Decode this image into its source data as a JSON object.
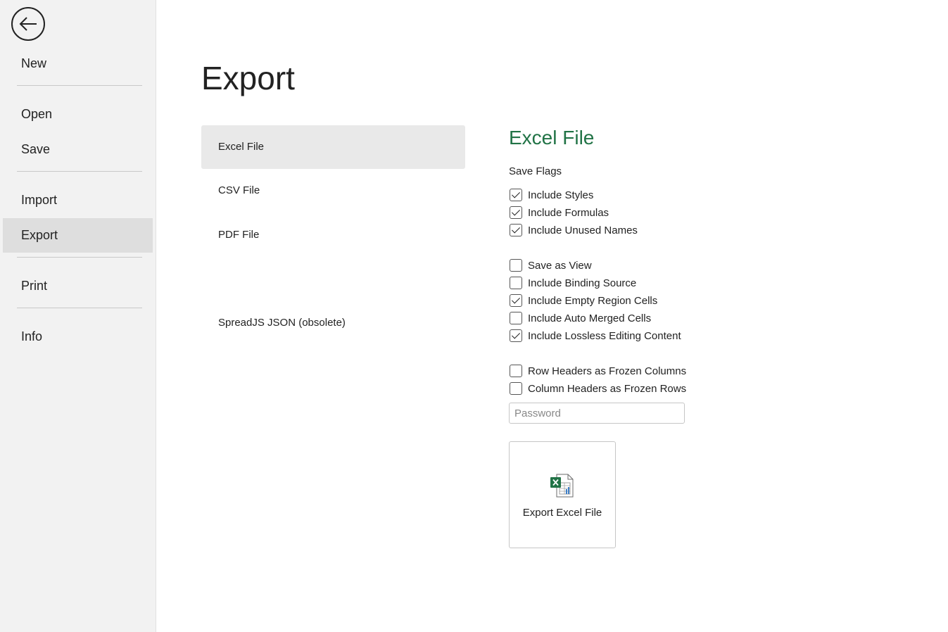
{
  "sidebar": {
    "items": [
      {
        "label": "New"
      },
      {
        "label": "Open"
      },
      {
        "label": "Save"
      },
      {
        "label": "Import"
      },
      {
        "label": "Export"
      },
      {
        "label": "Print"
      },
      {
        "label": "Info"
      }
    ],
    "active": "Export"
  },
  "main": {
    "title": "Export",
    "types": [
      {
        "label": "Excel File"
      },
      {
        "label": "CSV File"
      },
      {
        "label": "PDF File"
      },
      {
        "label": "SpreadJS JSON (obsolete)"
      }
    ]
  },
  "panel": {
    "title": "Excel File",
    "flags_label": "Save Flags",
    "options": [
      {
        "label": "Include Styles",
        "checked": true
      },
      {
        "label": "Include Formulas",
        "checked": true
      },
      {
        "label": "Include Unused Names",
        "checked": true
      },
      {
        "label": "Save as View",
        "checked": false
      },
      {
        "label": "Include Binding Source",
        "checked": false
      },
      {
        "label": "Include Empty Region Cells",
        "checked": true
      },
      {
        "label": "Include Auto Merged Cells",
        "checked": false
      },
      {
        "label": "Include Lossless Editing Content",
        "checked": true
      },
      {
        "label": "Row Headers as Frozen Columns",
        "checked": false
      },
      {
        "label": "Column Headers as Frozen Rows",
        "checked": false
      }
    ],
    "password_placeholder": "Password",
    "export_button_label": "Export Excel File",
    "accent_color": "#217346"
  }
}
